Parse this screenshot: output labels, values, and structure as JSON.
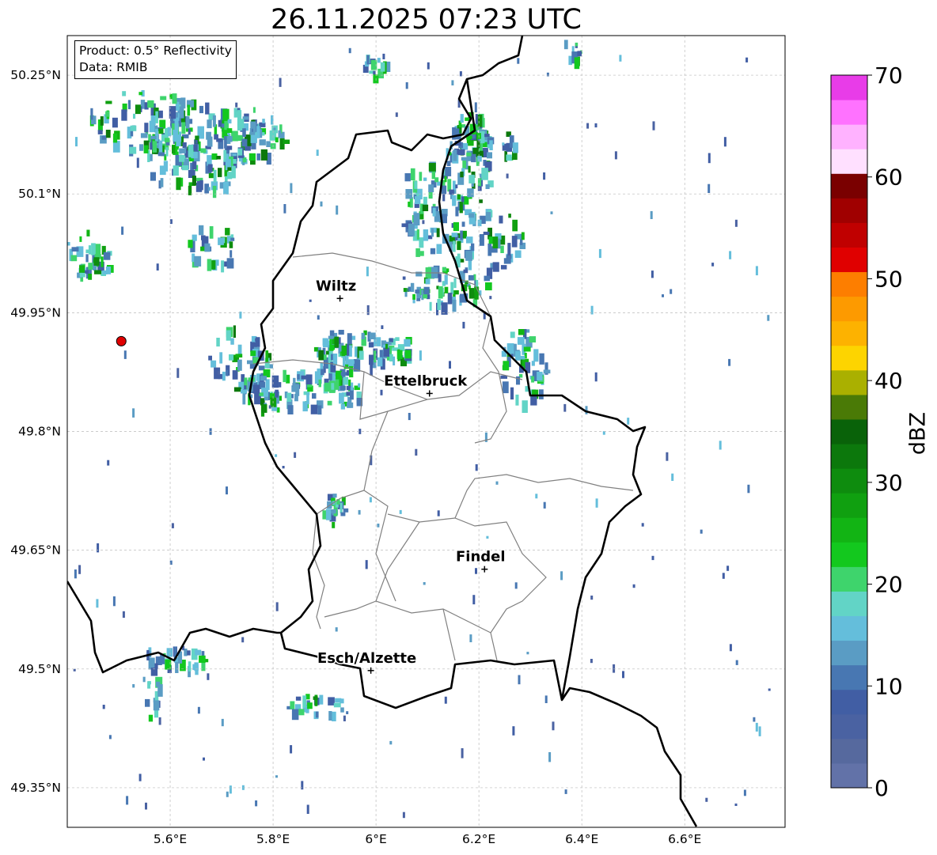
{
  "title": "26.11.2025 07:23 UTC",
  "info": {
    "product": "Product: 0.5° Reflectivity",
    "data": "Data: RMIB"
  },
  "axes": {
    "lon_ticks": [
      "5.6°E",
      "5.8°E",
      "6°E",
      "6.2°E",
      "6.4°E",
      "6.6°E"
    ],
    "lat_ticks": [
      "50.25°N",
      "50.1°N",
      "49.95°N",
      "49.8°N",
      "49.65°N",
      "49.5°N",
      "49.35°N"
    ]
  },
  "cities": [
    {
      "name": "Wiltz",
      "lon": 5.93,
      "lat": 49.968
    },
    {
      "name": "Ettelbruck",
      "lon": 6.104,
      "lat": 49.848
    },
    {
      "name": "Findel",
      "lon": 6.211,
      "lat": 49.626
    },
    {
      "name": "Esch/Alzette",
      "lon": 5.99,
      "lat": 49.498
    }
  ],
  "radar_site": {
    "lon": 5.505,
    "lat": 49.914,
    "color": "#e00000"
  },
  "colorbar": {
    "label": "dBZ",
    "min": 0,
    "max": 70,
    "tick_labels": [
      "0",
      "10",
      "20",
      "30",
      "40",
      "50",
      "60",
      "70"
    ],
    "colors": [
      "#6272a8",
      "#56699e",
      "#4a62a2",
      "#415ea4",
      "#4877b2",
      "#5a9cc4",
      "#64bedb",
      "#62d4c6",
      "#3ed46c",
      "#13c81e",
      "#12b414",
      "#10a010",
      "#0e8c0e",
      "#0c780c",
      "#096209",
      "#4a7a06",
      "#aab000",
      "#fdd400",
      "#fdb200",
      "#fd9a00",
      "#fd7e00",
      "#e00000",
      "#c00000",
      "#a00000",
      "#7a0000",
      "#ffe0ff",
      "#ffb2ff",
      "#ff72ff",
      "#e83ce8"
    ]
  },
  "colors": {
    "border": "#000000",
    "cantons": "#808080",
    "grid": "#bbbbbb"
  }
}
